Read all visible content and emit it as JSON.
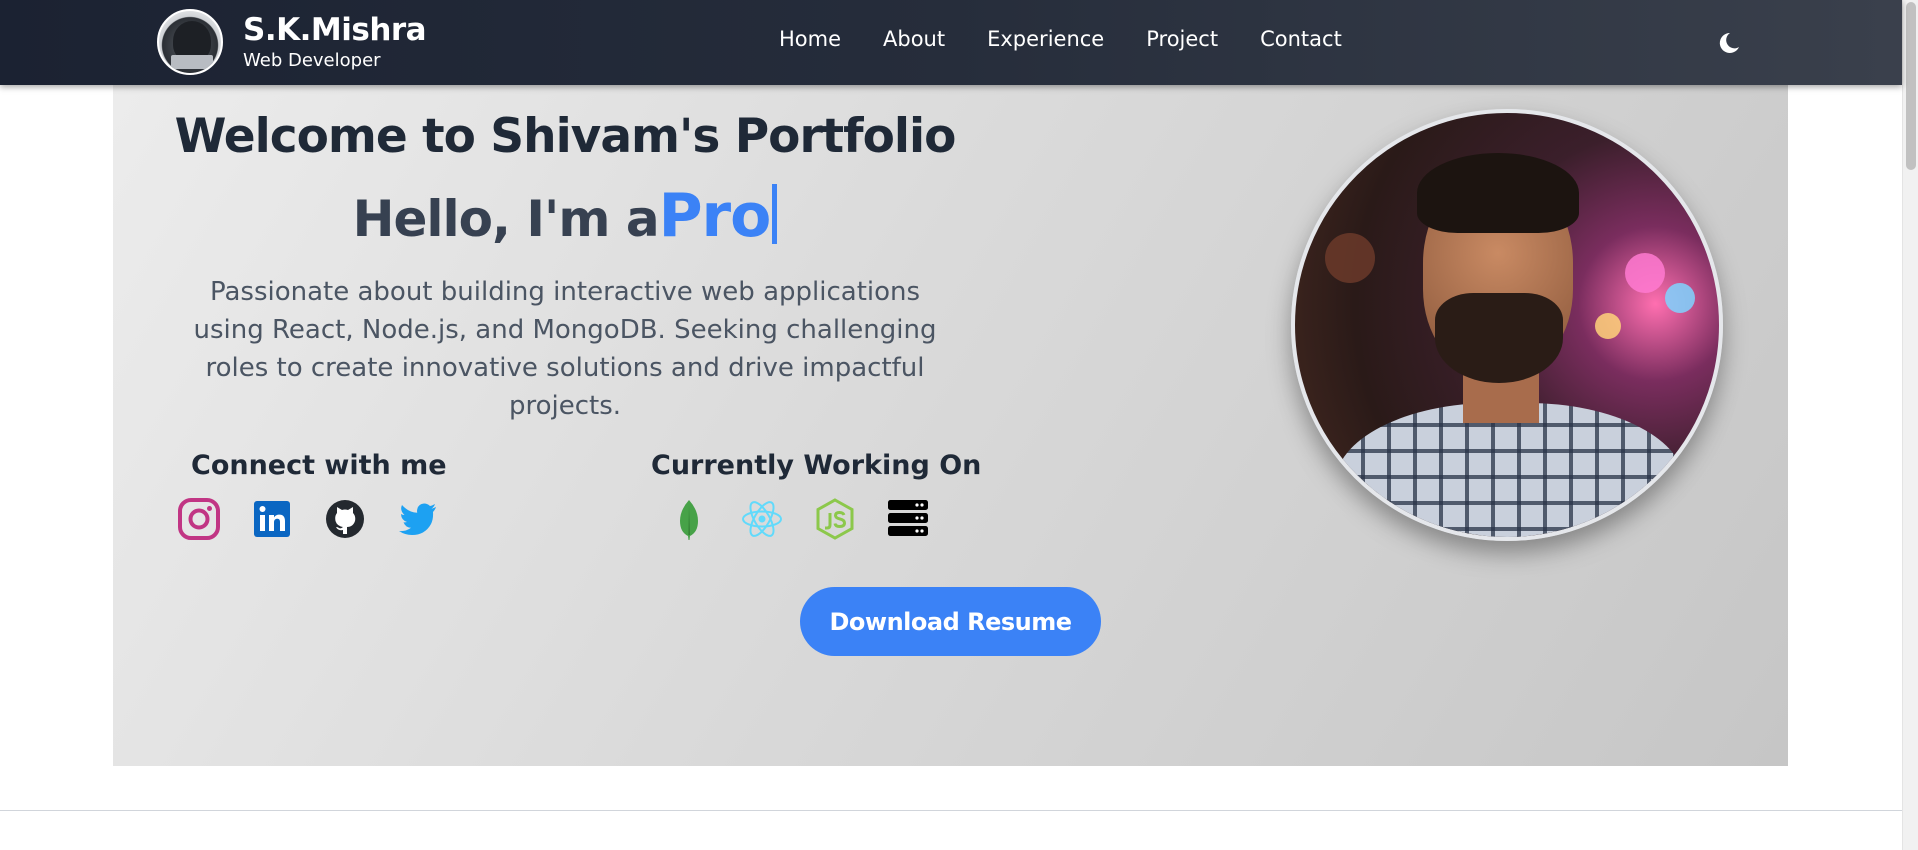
{
  "navbar": {
    "brand_name": "S.K.Mishra",
    "brand_role": "Web Developer",
    "links": [
      "Home",
      "About",
      "Experience",
      "Project",
      "Contact"
    ],
    "theme_icon": "moon-icon"
  },
  "hero": {
    "title": "Welcome to Shivam's Portfolio",
    "hello_prefix": "Hello, I'm a",
    "typed_text": "Pro",
    "description": "Passionate about building interactive web applications using React, Node.js, and MongoDB. Seeking challenging roles to create innovative solutions and drive impactful projects.",
    "connect_title": "Connect with me",
    "working_title": "Currently Working On",
    "social_icons": [
      "instagram-icon",
      "linkedin-icon",
      "github-icon",
      "twitter-icon"
    ],
    "tech_icons": [
      "mongodb-icon",
      "react-icon",
      "nodejs-icon",
      "express-server-icon"
    ],
    "resume_button": "Download Resume"
  },
  "colors": {
    "accent": "#3b82f6",
    "navbar": "#1b2232",
    "heading": "#1f2937"
  }
}
